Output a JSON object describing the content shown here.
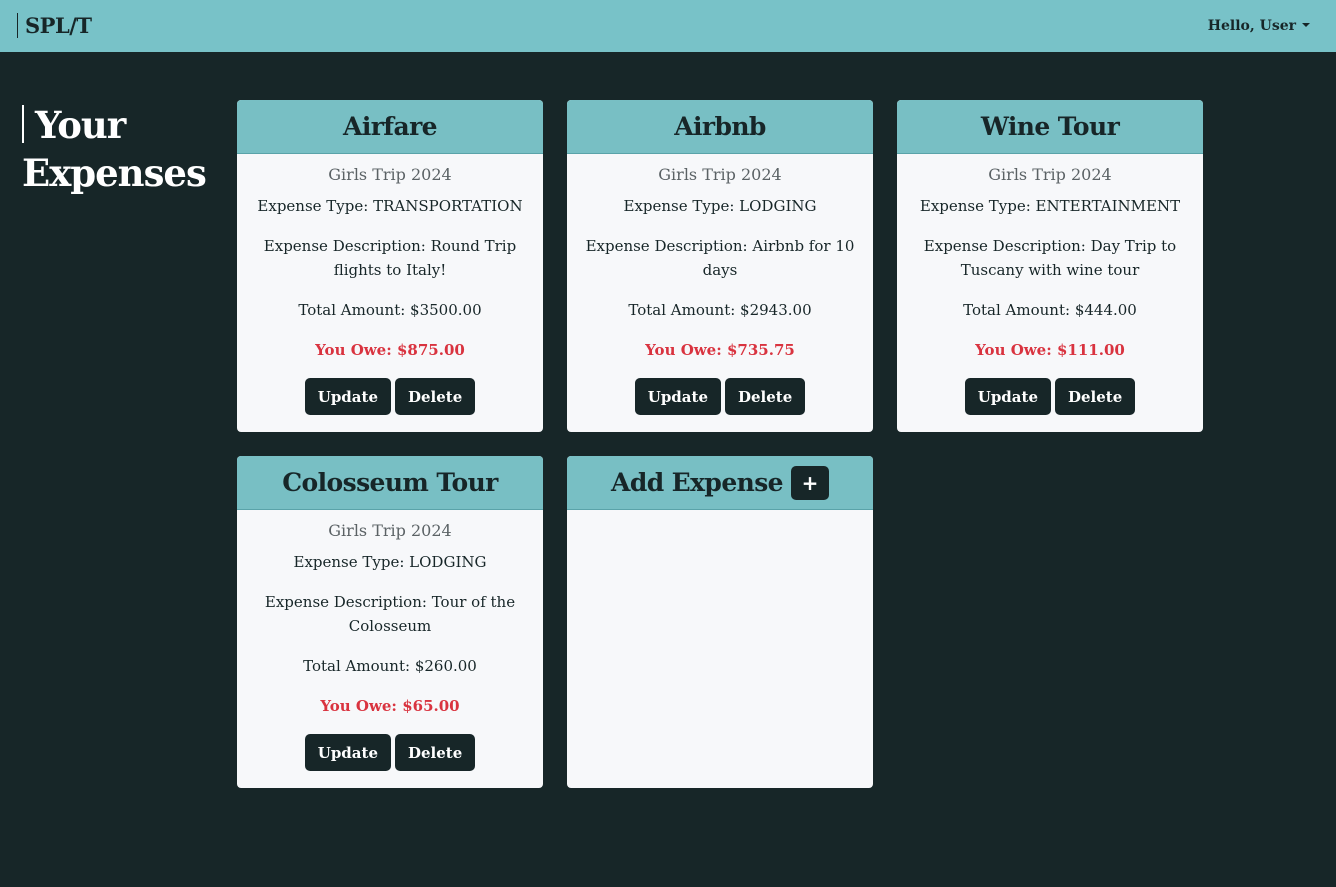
{
  "navbar": {
    "brand": "SPL/T",
    "user_greeting": "Hello, User"
  },
  "page": {
    "title_line1": "Your",
    "title_line2": "Expenses"
  },
  "labels": {
    "type_prefix": "Expense Type: ",
    "description_prefix": "Expense Description: ",
    "total_prefix": "Total Amount: ",
    "owe_prefix": "You Owe: ",
    "update": "Update",
    "delete": "Delete"
  },
  "expenses": [
    {
      "name": "Airfare",
      "trip": "Girls Trip 2024",
      "type": "TRANSPORTATION",
      "description": "Round Trip flights to Italy!",
      "total": "$3500.00",
      "owe": "$875.00"
    },
    {
      "name": "Airbnb",
      "trip": "Girls Trip 2024",
      "type": "LODGING",
      "description": "Airbnb for 10 days",
      "total": "$2943.00",
      "owe": "$735.75"
    },
    {
      "name": "Wine Tour",
      "trip": "Girls Trip 2024",
      "type": "ENTERTAINMENT",
      "description": "Day Trip to Tuscany with wine tour",
      "total": "$444.00",
      "owe": "$111.00"
    },
    {
      "name": "Colosseum Tour",
      "trip": "Girls Trip 2024",
      "type": "LODGING",
      "description": "Tour of the Colosseum",
      "total": "$260.00",
      "owe": "$65.00"
    }
  ],
  "add_card": {
    "title": "Add Expense",
    "button_icon": "plus-icon",
    "button_symbol": "+"
  },
  "colors": {
    "navbar": "#78c2c8",
    "background": "#172628",
    "card_header": "#78bfc4",
    "card_body": "#f7f8fa",
    "owe": "#d9333f",
    "button": "#172628"
  }
}
